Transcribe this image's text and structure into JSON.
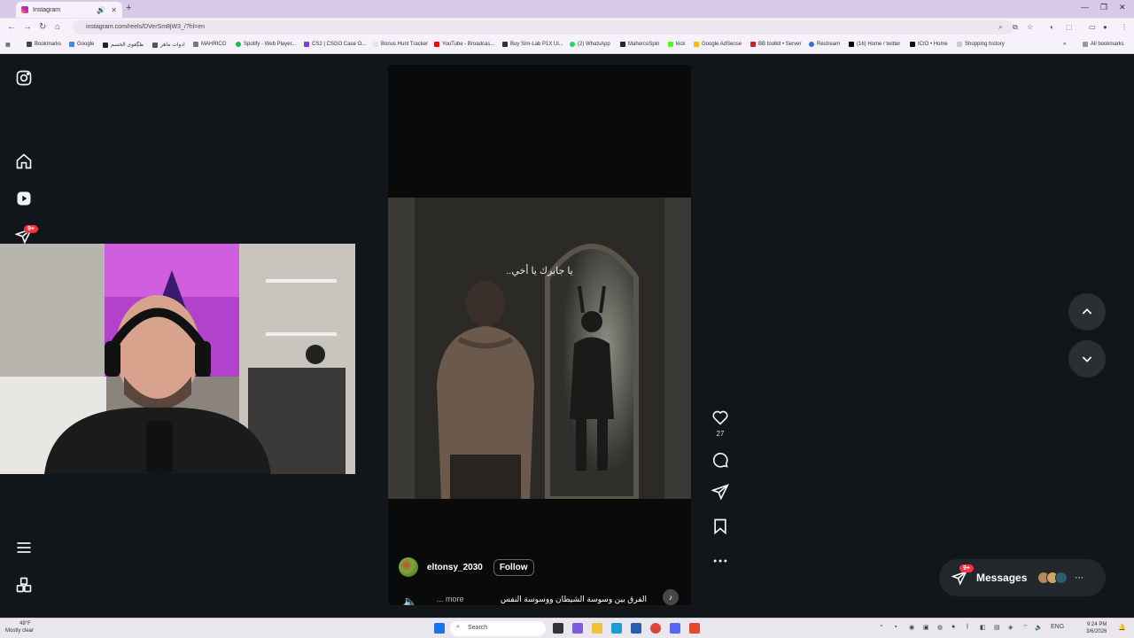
{
  "browser": {
    "tab_title": "Instagram",
    "url": "instagram.com/reels/DVerSm8jW3_/?hl=en",
    "bookmarks": [
      "Bookmarks",
      "Google",
      "ظڳعوی الخسم",
      "ادوات ماهر",
      "MAHRICO",
      "Spotify - Web Player...",
      "CS2 | CSGO Case O...",
      "Bonus Hunt Tracker",
      "YouTube - Broadcas...",
      "Buy Sim-Lab P1X Ul...",
      "(2) WhatsApp",
      "MahercoSpin",
      "kick",
      "Google AdSense",
      "BB toolkit • Server",
      "Restream",
      "(16) Home / twitter",
      "ICIO • Home",
      "Shopping history"
    ],
    "all_bookmarks": "All bookmarks"
  },
  "sidebar": {
    "notifications_badge": "9+"
  },
  "reel": {
    "overlay_text": "يا جابرك يا أخي..",
    "username": "eltonsy_2030",
    "follow_label": "Follow",
    "description": "الفرق بين وسوسة الشيطان ووسوسة النفس",
    "more_label": "... more",
    "like_count": "27"
  },
  "messages": {
    "label": "Messages",
    "badge": "9+"
  },
  "taskbar": {
    "weather_temp": "49°F",
    "weather_desc": "Mostly clear",
    "search_placeholder": "Search",
    "time": "9:24 PM",
    "date": "3/6/2026",
    "lang": "ENG"
  },
  "colors": {
    "badge": "#ff3040",
    "page_bg": "#11161a",
    "reel_bg": "#0a0a0a"
  }
}
